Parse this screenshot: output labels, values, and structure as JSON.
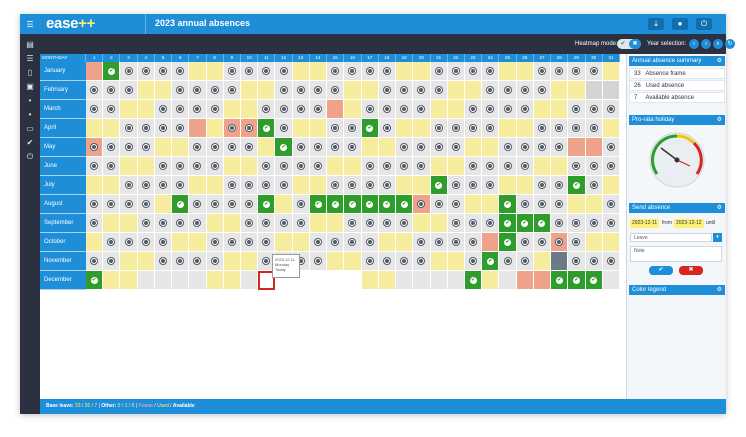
{
  "app": {
    "logo": "ease",
    "logo_plus": "++",
    "title": "2023 annual absences"
  },
  "toolbar": {
    "heatmap_label": "Heatmap mode:",
    "year_label": "Year selection:"
  },
  "calendar": {
    "header_month": "MONTHDAY",
    "days": [
      "1",
      "2",
      "3",
      "4",
      "5",
      "6",
      "7",
      "8",
      "9",
      "10",
      "11",
      "12",
      "13",
      "14",
      "15",
      "16",
      "17",
      "18",
      "19",
      "20",
      "21",
      "22",
      "23",
      "24",
      "25",
      "26",
      "27",
      "28",
      "29",
      "30",
      "31"
    ],
    "months": [
      {
        "name": "January",
        "cells": "ywddddyyddddyyddddyyddddyyddddy",
        "special": {
          "1": "r",
          "2": "g"
        }
      },
      {
        "name": "February",
        "cells": "dddyyddddyyddddyyddddyyddddyyxxx",
        "special": {}
      },
      {
        "name": "March",
        "cells": "ddyyddddyyddddyyddddyyddddyydddd",
        "special": {
          "15": "r"
        }
      },
      {
        "name": "April",
        "cells": "yyddddyyddddyyddddyyddddyyddddy",
        "special": {
          "7": "r",
          "9": "r",
          "10": "r",
          "11": "g",
          "17": "g"
        }
      },
      {
        "name": "May",
        "cells": "ddddyyddddyyddddyyddddyyddddyydd",
        "special": {
          "1": "r",
          "12": "g",
          "29": "r",
          "30": "r"
        }
      },
      {
        "name": "June",
        "cells": "ddyyddddyyddddyyddddyyddddyydddx",
        "special": {}
      },
      {
        "name": "July",
        "cells": "yyddddyyddddyyddddyyddddyyddddyy",
        "special": {
          "21": "g",
          "29": "g"
        }
      },
      {
        "name": "August",
        "cells": "ddddyyddddyyddddyyddddyyddddyydd",
        "special": {
          "6": "g",
          "11": "g",
          "14": "g",
          "15": "g",
          "16": "g",
          "17": "g",
          "18": "g",
          "19": "g",
          "20": "r",
          "25": "g"
        }
      },
      {
        "name": "September",
        "cells": "dyyddddyyddddyyddddyyddddyyddddx",
        "special": {
          "25": "g",
          "26": "g",
          "27": "g"
        }
      },
      {
        "name": "October",
        "cells": "yddddyyddddyyddddyyddddyyddddyyd",
        "special": {
          "24": "r",
          "25": "g",
          "28": "r"
        }
      },
      {
        "name": "November",
        "cells": "ddyyddddyyddddyyddddyyddddyydddx",
        "special": {
          "24": "g",
          "28": "s"
        }
      },
      {
        "name": "December",
        "cells": "dyyddddyydtbbbbbyyddddyydddyyddddy",
        "special": {
          "1": "g",
          "23": "g",
          "26": "r",
          "27": "r",
          "28": "g",
          "29": "g",
          "30": "g"
        }
      }
    ],
    "tooltip": {
      "line1": "2023.12.11.",
      "line2": "Monday",
      "line3": "Today"
    }
  },
  "status": {
    "label_base": "Base leave:",
    "base_values": "33 / 26 / 7",
    "label_other": "Other:",
    "other_values": "0 / 1 / 0",
    "legend_frame": "Frame",
    "legend_used": "Used",
    "legend_available": "Available"
  },
  "sidebar": {
    "summary_title": "Annual absence summary",
    "summary": [
      {
        "n": "33",
        "label": "Absence frame"
      },
      {
        "n": "26",
        "label": "Used absence"
      },
      {
        "n": "7",
        "label": "Available absence"
      }
    ],
    "prorata_title": "Pro-rata holiday",
    "send_title": "Send absence",
    "date_from": "2023-12-11",
    "from_word": "from",
    "date_to": "2023-12-12",
    "until_word": "until",
    "leave_type": "Leave",
    "note_placeholder": "Note",
    "legend_title": "Color legend"
  },
  "colors": {
    "accent": "#1e8ed8",
    "rail": "#2b3140",
    "workday": "#e6e6e6",
    "weekend": "#f5ec9d",
    "absence": "#2e9d2b",
    "holiday": "#eea28a"
  }
}
